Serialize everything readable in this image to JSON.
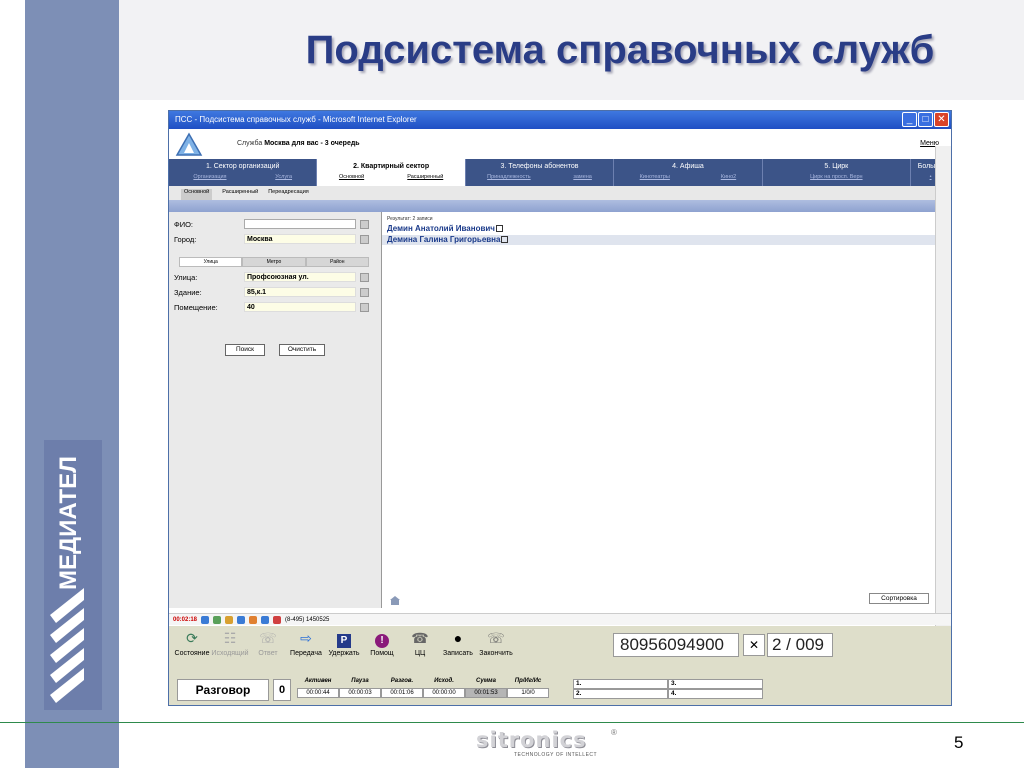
{
  "slide": {
    "title": "Подсистема справочных служб",
    "page_number": "5",
    "brand": {
      "name": "sitronics",
      "tagline": "TECHNOLOGY OF INTELLECT"
    },
    "side_logo_text": "МЕДИАТЕЛ"
  },
  "window": {
    "title": "ПСС - Подсистема справочных служб - Microsoft Internet Explorer",
    "min": "_",
    "max": "□",
    "close": "✕"
  },
  "app": {
    "service_label": "Служба",
    "service_value": "Москва для вас - 3 очередь",
    "menu_label": "Меню",
    "tabs": [
      {
        "label": "1. Сектор организаций",
        "subs": [
          "Организация",
          "Услуга"
        ]
      },
      {
        "label": "2. Квартирный сектор",
        "subs": [
          "Основной",
          "Расширенный"
        ]
      },
      {
        "label": "3. Телефоны абонентов",
        "subs": [
          "Принадлежность",
          "замена"
        ]
      },
      {
        "label": "4. Афиша",
        "subs": [
          "Кинотеатры",
          "Кино2"
        ]
      },
      {
        "label": "5. Цирк",
        "subs": [
          "Цирк на просп. Верн"
        ]
      },
      {
        "label": "Больше",
        "subs": [
          "•"
        ]
      }
    ],
    "subtabs": [
      "Основной",
      "Расширенный",
      "Переадресация"
    ]
  },
  "search_form": {
    "fio_label": "ФИО:",
    "fio_value": "",
    "city_label": "Город:",
    "city_value": "Москва",
    "address_tabs": [
      "Улица",
      "Метро",
      "Район"
    ],
    "street_label": "Улица:",
    "street_value": "Профсоюзная ул.",
    "building_label": "Здание:",
    "building_value": "85,к.1",
    "room_label": "Помещение:",
    "room_value": "40",
    "search_button": "Поиск",
    "clear_button": "Очистить"
  },
  "results": {
    "header": "Результат: 2 записи",
    "rows": [
      "Демин Анатолий Иванович",
      "Демина Галина Григорьевна"
    ],
    "sort_button": "Сортировка"
  },
  "statusline": {
    "timer": "00:02:18",
    "phone": "(8-495) 1450525"
  },
  "toolbar": {
    "buttons": [
      {
        "label": "Состояние",
        "icon": "state-icon",
        "enabled": true
      },
      {
        "label": "Исходящий",
        "icon": "outgoing-icon",
        "enabled": false
      },
      {
        "label": "Ответ",
        "icon": "answer-icon",
        "enabled": false
      },
      {
        "label": "Передача",
        "icon": "transfer-icon",
        "enabled": true
      },
      {
        "label": "Удержать",
        "icon": "hold-icon",
        "enabled": true
      },
      {
        "label": "Помощ",
        "icon": "help-icon",
        "enabled": true
      },
      {
        "label": "ЦЦ",
        "icon": "cc-icon",
        "enabled": true
      },
      {
        "label": "Записать",
        "icon": "record-icon",
        "enabled": true
      },
      {
        "label": "Закончить",
        "icon": "end-icon",
        "enabled": true
      }
    ],
    "phone_number": "80956094900",
    "queue": "2 / 009"
  },
  "callinfo": {
    "state": "Разговор",
    "count": "0",
    "stats": [
      {
        "label": "Активен",
        "value": "00:00:44"
      },
      {
        "label": "Пауза",
        "value": "00:00:03"
      },
      {
        "label": "Разгов.",
        "value": "00:01:06"
      },
      {
        "label": "Исход.",
        "value": "00:00:00"
      },
      {
        "label": "Сумма",
        "value": "00:01:53"
      },
      {
        "label": "Пр/Иг/Ис",
        "value": "1/0/0"
      }
    ],
    "slots": [
      [
        "1.",
        "3."
      ],
      [
        "2.",
        "4."
      ]
    ]
  },
  "colors": {
    "title": "#2a3d86",
    "left_band": "#7d8fb6",
    "tab_bar": "#3c5488",
    "toolbar_bg": "#dedeca",
    "result_text": "#1a3a8a",
    "timer": "#cc0000"
  }
}
